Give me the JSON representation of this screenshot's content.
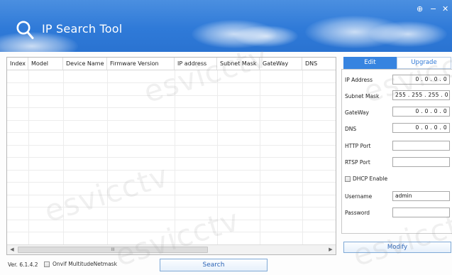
{
  "header": {
    "title": "IP Search Tool",
    "window_controls": {
      "settings": "⊕",
      "minimize": "−",
      "close": "✕"
    }
  },
  "watermark_text": "esvicctv",
  "device_table": {
    "columns": [
      "Index",
      "Model",
      "Device Name",
      "Firmware Version",
      "IP address",
      "Subnet Mask",
      "GateWay",
      "DNS"
    ],
    "rows": [],
    "scroll_thumb_grip": "III",
    "scroll_left": "◀",
    "scroll_right": "▶"
  },
  "footer": {
    "version": "Ver. 6.1.4.2",
    "onvif_label": "Onvif MultitudeNetmask",
    "onvif_checked": false,
    "search_label": "Search"
  },
  "edit_panel": {
    "tabs": {
      "edit": "Edit",
      "upgrade": "Upgrade"
    },
    "active_tab": "Edit",
    "fields": {
      "ip_address": {
        "label": "IP Address",
        "value": "0  .  0  .  0  .  0"
      },
      "subnet_mask": {
        "label": "Subnet Mask",
        "value": "255 . 255 . 255 .  0"
      },
      "gateway": {
        "label": "GateWay",
        "value": "0  .  0  .  0  .  0"
      },
      "dns": {
        "label": "DNS",
        "value": "0  .  0  .  0  .  0"
      },
      "http_port": {
        "label": "HTTP Port",
        "value": ""
      },
      "rtsp_port": {
        "label": "RTSP Port",
        "value": ""
      },
      "username": {
        "label": "Username",
        "value": "admin"
      },
      "password": {
        "label": "Password",
        "value": ""
      }
    },
    "dhcp_label": "DHCP Enable",
    "dhcp_checked": false,
    "modify_label": "Modify"
  },
  "colors": {
    "header_blue": "#2f7ad8",
    "tab_active": "#3784e0",
    "button_text": "#2b63b5"
  }
}
